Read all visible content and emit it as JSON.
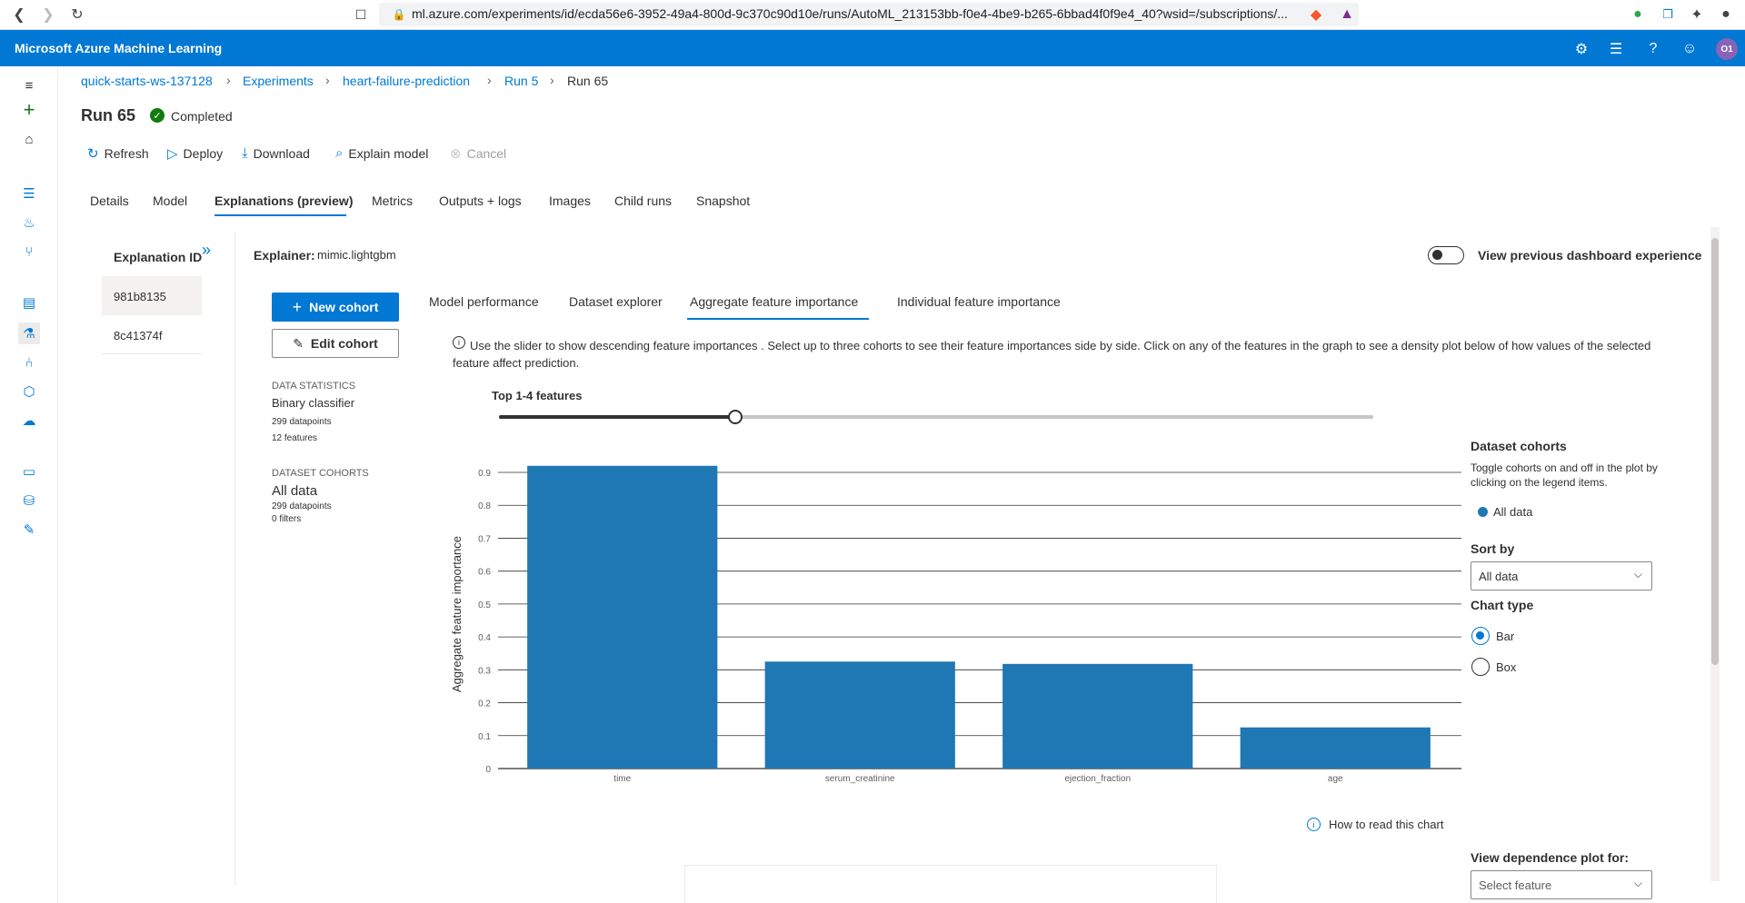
{
  "browser": {
    "url": "ml.azure.com/experiments/id/ecda56e6-3952-49a4-800d-9c370c90d10e/runs/AutoML_213153bb-f0e4-4be9-b265-6bbad4f0f9e4_40?wsid=/subscriptions/..."
  },
  "header": {
    "app_title": "Microsoft Azure Machine Learning",
    "avatar_initials": "O1"
  },
  "breadcrumb": [
    "quick-starts-ws-137128",
    "Experiments",
    "heart-failure-prediction",
    "Run 5",
    "Run 65"
  ],
  "run": {
    "title": "Run 65",
    "status": "Completed"
  },
  "toolbar": {
    "refresh": "Refresh",
    "deploy": "Deploy",
    "download": "Download",
    "explain_model": "Explain model",
    "cancel": "Cancel"
  },
  "tabs": [
    "Details",
    "Model",
    "Explanations (preview)",
    "Metrics",
    "Outputs + logs",
    "Images",
    "Child runs",
    "Snapshot"
  ],
  "explanations": {
    "header": "Explanation ID",
    "ids": [
      "981b8135",
      "8c41374f"
    ]
  },
  "explainer": {
    "label": "Explainer:",
    "value": "mimic.lightgbm"
  },
  "toggle": {
    "label": "View previous dashboard experience"
  },
  "cohort_buttons": {
    "new": "New cohort",
    "edit": "Edit cohort"
  },
  "data_statistics": {
    "title": "DATA STATISTICS",
    "classifier": "Binary classifier",
    "datapoints": "299 datapoints",
    "features": "12 features"
  },
  "dataset_cohorts": {
    "title": "DATASET COHORTS",
    "name": "All data",
    "datapoints": "299 datapoints",
    "filters": "0 filters"
  },
  "dashboard_tabs": [
    "Model performance",
    "Dataset explorer",
    "Aggregate feature importance",
    "Individual feature importance"
  ],
  "info_text": "Use the slider to show descending feature importances . Select up to three cohorts to see their feature importances side by side. Click on any of the features in the graph to see a density plot below of how values of the selected feature affect prediction.",
  "slider": {
    "label": "Top 1-4 features",
    "fraction": 0.27
  },
  "legend_panel": {
    "title": "Dataset cohorts",
    "description": "Toggle cohorts on and off in the plot by clicking on the legend items.",
    "item": "All data"
  },
  "sort_by": {
    "label": "Sort by",
    "value": "All data"
  },
  "chart_type": {
    "label": "Chart type",
    "options": [
      "Bar",
      "Box"
    ],
    "selected": "Bar"
  },
  "how_to_read": "How to read this chart",
  "dependence": {
    "label": "View dependence plot for:",
    "placeholder": "Select feature"
  },
  "chart_data": {
    "type": "bar",
    "categories": [
      "time",
      "serum_creatinine",
      "ejection_fraction",
      "age"
    ],
    "values": [
      0.92,
      0.325,
      0.318,
      0.125
    ],
    "ylabel": "Aggregate feature importance",
    "xlabel": "",
    "ylim": [
      0,
      0.9
    ],
    "yticks": [
      0,
      0.1,
      0.2,
      0.3,
      0.4,
      0.5,
      0.6,
      0.7,
      0.8,
      0.9
    ],
    "color": "#1f77b4",
    "grid": true
  }
}
